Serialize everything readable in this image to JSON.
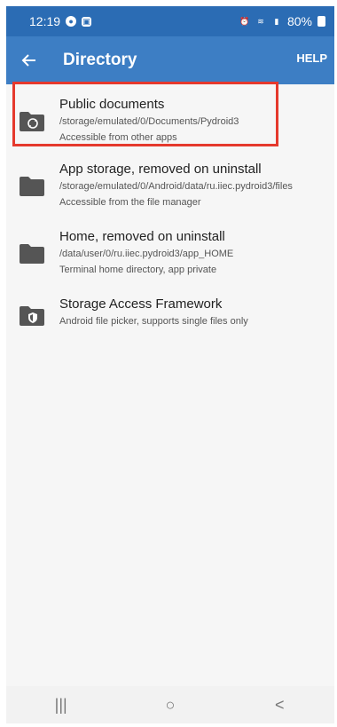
{
  "status_bar": {
    "time": "12:19",
    "battery": "80%"
  },
  "app_bar": {
    "title": "Directory",
    "help": "HELP"
  },
  "items": [
    {
      "title": "Public documents",
      "path": "/storage/emulated/0/Documents/Pydroid3",
      "desc": "Accessible from other apps",
      "icon": "folder-sync-icon"
    },
    {
      "title": "App storage, removed on uninstall",
      "path": "/storage/emulated/0/Android/data/ru.iiec.pydroid3/files",
      "desc": "Accessible from the file manager",
      "icon": "folder-icon"
    },
    {
      "title": "Home, removed on uninstall",
      "path": "/data/user/0/ru.iiec.pydroid3/app_HOME",
      "desc": "Terminal home directory, app private",
      "icon": "folder-icon"
    },
    {
      "title": "Storage Access Framework",
      "path": "",
      "desc": "Android file picker, supports single files only",
      "icon": "folder-shield-icon"
    }
  ],
  "nav": {
    "recents": "|||",
    "home": "○",
    "back": "<"
  },
  "colors": {
    "status_bar": "#2b6cb4",
    "app_bar": "#3d7ec4",
    "highlight": "#e5392d"
  }
}
